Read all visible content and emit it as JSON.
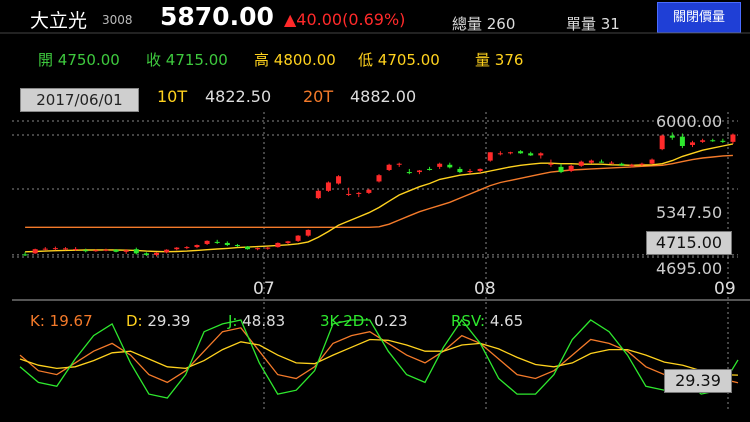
{
  "header": {
    "name": "大立光",
    "code": "3008",
    "price": "5870.00",
    "change": "▲40.00(0.69%)",
    "total_volume": "總量 260",
    "single_volume": "單量 31",
    "toggle_button": "關閉價量"
  },
  "ohlc": {
    "open_label": "開",
    "open": "4750.00",
    "close_label": "收",
    "close": "4715.00",
    "high_label": "高",
    "high": "4800.00",
    "low_label": "低",
    "low": "4705.00",
    "volume_label": "量",
    "volume": "376"
  },
  "selected_date": "2017/06/01",
  "ma": {
    "ma10_label": "10T",
    "ma10_value": "4822.50",
    "ma20_label": "20T",
    "ma20_value": "4882.00"
  },
  "price_axis": {
    "top": "6000.00",
    "mid": "5347.50",
    "selected": "4715.00",
    "bottom": "4695.00"
  },
  "x_ticks": [
    "07",
    "08",
    "09"
  ],
  "kd": {
    "k_label": "K:",
    "k_value": "19.67",
    "d_label": "D:",
    "d_value": "29.39",
    "j_label": "J:",
    "j_value": "48.83",
    "k2d_label": "3K-2D:",
    "k2d_value": "0.23",
    "rsv_label": "RSV:",
    "rsv_value": "4.65",
    "selected": "29.39"
  },
  "colors": {
    "up": "#ff2a2a",
    "down": "#2ee82e",
    "ma10": "#ffd21e",
    "ma20": "#f47a2a",
    "k": "#f47a2a",
    "d": "#ffd21e",
    "j": "#2ee82e"
  },
  "chart_data": [
    {
      "type": "candlestick",
      "title": "",
      "ylim": [
        4695,
        6000
      ],
      "x_ticks": [
        "07",
        "08",
        "09"
      ],
      "candles": [
        {
          "o": 4720,
          "h": 4740,
          "l": 4705,
          "c": 4715
        },
        {
          "o": 4730,
          "h": 4775,
          "l": 4725,
          "c": 4770
        },
        {
          "o": 4770,
          "h": 4790,
          "l": 4760,
          "c": 4775
        },
        {
          "o": 4775,
          "h": 4795,
          "l": 4760,
          "c": 4780
        },
        {
          "o": 4775,
          "h": 4790,
          "l": 4760,
          "c": 4778
        },
        {
          "o": 4770,
          "h": 4790,
          "l": 4755,
          "c": 4772
        },
        {
          "o": 4760,
          "h": 4775,
          "l": 4740,
          "c": 4755
        },
        {
          "o": 4755,
          "h": 4770,
          "l": 4745,
          "c": 4760
        },
        {
          "o": 4760,
          "h": 4775,
          "l": 4750,
          "c": 4765
        },
        {
          "o": 4765,
          "h": 4770,
          "l": 4740,
          "c": 4745
        },
        {
          "o": 4745,
          "h": 4770,
          "l": 4725,
          "c": 4760
        },
        {
          "o": 4770,
          "h": 4785,
          "l": 4720,
          "c": 4730
        },
        {
          "o": 4730,
          "h": 4740,
          "l": 4705,
          "c": 4715
        },
        {
          "o": 4715,
          "h": 4740,
          "l": 4700,
          "c": 4735
        },
        {
          "o": 4740,
          "h": 4770,
          "l": 4730,
          "c": 4765
        },
        {
          "o": 4770,
          "h": 4790,
          "l": 4760,
          "c": 4785
        },
        {
          "o": 4785,
          "h": 4800,
          "l": 4770,
          "c": 4790
        },
        {
          "o": 4790,
          "h": 4815,
          "l": 4780,
          "c": 4810
        },
        {
          "o": 4820,
          "h": 4855,
          "l": 4810,
          "c": 4850
        },
        {
          "o": 4840,
          "h": 4860,
          "l": 4820,
          "c": 4830
        },
        {
          "o": 4830,
          "h": 4845,
          "l": 4800,
          "c": 4810
        },
        {
          "o": 4810,
          "h": 4820,
          "l": 4790,
          "c": 4800
        },
        {
          "o": 4795,
          "h": 4800,
          "l": 4765,
          "c": 4770
        },
        {
          "o": 4770,
          "h": 4785,
          "l": 4760,
          "c": 4780
        },
        {
          "o": 4775,
          "h": 4790,
          "l": 4765,
          "c": 4785
        },
        {
          "o": 4790,
          "h": 4835,
          "l": 4785,
          "c": 4830
        },
        {
          "o": 4830,
          "h": 4850,
          "l": 4820,
          "c": 4845
        },
        {
          "o": 4850,
          "h": 4905,
          "l": 4840,
          "c": 4900
        },
        {
          "o": 4900,
          "h": 4960,
          "l": 4890,
          "c": 4955
        },
        {
          "o": 5260,
          "h": 5340,
          "l": 5250,
          "c": 5330
        },
        {
          "o": 5330,
          "h": 5420,
          "l": 5320,
          "c": 5410
        },
        {
          "o": 5400,
          "h": 5480,
          "l": 5390,
          "c": 5470
        },
        {
          "o": 5300,
          "h": 5360,
          "l": 5280,
          "c": 5300
        },
        {
          "o": 5300,
          "h": 5320,
          "l": 5270,
          "c": 5310
        },
        {
          "o": 5310,
          "h": 5350,
          "l": 5300,
          "c": 5340
        },
        {
          "o": 5420,
          "h": 5490,
          "l": 5410,
          "c": 5480
        },
        {
          "o": 5530,
          "h": 5590,
          "l": 5520,
          "c": 5580
        },
        {
          "o": 5580,
          "h": 5600,
          "l": 5560,
          "c": 5590
        },
        {
          "o": 5510,
          "h": 5540,
          "l": 5490,
          "c": 5500
        },
        {
          "o": 5510,
          "h": 5530,
          "l": 5490,
          "c": 5525
        },
        {
          "o": 5540,
          "h": 5560,
          "l": 5525,
          "c": 5530
        },
        {
          "o": 5560,
          "h": 5600,
          "l": 5540,
          "c": 5590
        },
        {
          "o": 5580,
          "h": 5600,
          "l": 5545,
          "c": 5555
        },
        {
          "o": 5540,
          "h": 5560,
          "l": 5500,
          "c": 5510
        },
        {
          "o": 5510,
          "h": 5540,
          "l": 5495,
          "c": 5520
        },
        {
          "o": 5520,
          "h": 5545,
          "l": 5500,
          "c": 5540
        },
        {
          "o": 5620,
          "h": 5700,
          "l": 5610,
          "c": 5700
        },
        {
          "o": 5690,
          "h": 5710,
          "l": 5670,
          "c": 5690
        },
        {
          "o": 5690,
          "h": 5705,
          "l": 5680,
          "c": 5700
        },
        {
          "o": 5710,
          "h": 5720,
          "l": 5685,
          "c": 5690
        },
        {
          "o": 5690,
          "h": 5705,
          "l": 5665,
          "c": 5670
        },
        {
          "o": 5670,
          "h": 5700,
          "l": 5640,
          "c": 5690
        },
        {
          "o": 5580,
          "h": 5630,
          "l": 5560,
          "c": 5590
        },
        {
          "o": 5560,
          "h": 5590,
          "l": 5500,
          "c": 5510
        },
        {
          "o": 5520,
          "h": 5580,
          "l": 5510,
          "c": 5570
        },
        {
          "o": 5570,
          "h": 5620,
          "l": 5560,
          "c": 5610
        },
        {
          "o": 5600,
          "h": 5630,
          "l": 5590,
          "c": 5620
        },
        {
          "o": 5610,
          "h": 5630,
          "l": 5600,
          "c": 5605
        },
        {
          "o": 5600,
          "h": 5615,
          "l": 5590,
          "c": 5600
        },
        {
          "o": 5590,
          "h": 5600,
          "l": 5570,
          "c": 5575
        },
        {
          "o": 5570,
          "h": 5590,
          "l": 5555,
          "c": 5580
        },
        {
          "o": 5580,
          "h": 5600,
          "l": 5570,
          "c": 5590
        },
        {
          "o": 5590,
          "h": 5640,
          "l": 5585,
          "c": 5630
        },
        {
          "o": 5730,
          "h": 5870,
          "l": 5720,
          "c": 5860
        },
        {
          "o": 5860,
          "h": 5890,
          "l": 5820,
          "c": 5840
        },
        {
          "o": 5850,
          "h": 5880,
          "l": 5740,
          "c": 5760
        },
        {
          "o": 5770,
          "h": 5810,
          "l": 5750,
          "c": 5795
        },
        {
          "o": 5800,
          "h": 5830,
          "l": 5790,
          "c": 5815
        },
        {
          "o": 5815,
          "h": 5830,
          "l": 5800,
          "c": 5810
        },
        {
          "o": 5810,
          "h": 5830,
          "l": 5790,
          "c": 5800
        },
        {
          "o": 5800,
          "h": 5880,
          "l": 5780,
          "c": 5870
        }
      ],
      "ma10": [
        4745,
        4748,
        4752,
        4755,
        4758,
        4760,
        4762,
        4762,
        4763,
        4762,
        4760,
        4758,
        4752,
        4748,
        4746,
        4748,
        4752,
        4758,
        4765,
        4772,
        4778,
        4785,
        4790,
        4795,
        4800,
        4806,
        4812,
        4822,
        4840,
        4885,
        4940,
        5000,
        5040,
        5080,
        5120,
        5170,
        5230,
        5290,
        5330,
        5370,
        5400,
        5440,
        5460,
        5480,
        5490,
        5500,
        5520,
        5540,
        5560,
        5575,
        5585,
        5595,
        5595,
        5590,
        5590,
        5585,
        5585,
        5585,
        5580,
        5578,
        5575,
        5578,
        5580,
        5590,
        5620,
        5660,
        5690,
        5720,
        5740,
        5760,
        5780
      ],
      "ma20": [
        4980,
        4980,
        4980,
        4980,
        4980,
        4980,
        4980,
        4980,
        4980,
        4980,
        4980,
        4980,
        4980,
        4980,
        4980,
        4980,
        4980,
        4980,
        4980,
        4980,
        4980,
        4980,
        4980,
        4980,
        4980,
        4980,
        4980,
        4980,
        4980,
        4980,
        4980,
        4980,
        4980,
        4980,
        4980,
        4985,
        5010,
        5050,
        5090,
        5130,
        5160,
        5190,
        5220,
        5260,
        5300,
        5340,
        5380,
        5410,
        5430,
        5450,
        5470,
        5490,
        5510,
        5520,
        5530,
        5535,
        5540,
        5545,
        5550,
        5555,
        5560,
        5565,
        5570,
        5575,
        5590,
        5610,
        5630,
        5645,
        5655,
        5665,
        5670
      ]
    },
    {
      "type": "line",
      "title": "KD",
      "ylim": [
        0,
        100
      ],
      "series": [
        {
          "name": "K",
          "values": [
            55,
            35,
            30,
            45,
            60,
            70,
            55,
            30,
            20,
            35,
            60,
            85,
            90,
            60,
            30,
            25,
            40,
            70,
            80,
            85,
            70,
            55,
            45,
            60,
            80,
            70,
            50,
            30,
            25,
            35,
            55,
            75,
            70,
            60,
            40,
            30,
            35,
            20,
            25,
            19.67
          ]
        },
        {
          "name": "D",
          "values": [
            50,
            42,
            38,
            40,
            48,
            58,
            60,
            50,
            40,
            38,
            48,
            62,
            72,
            68,
            55,
            45,
            44,
            55,
            65,
            75,
            74,
            68,
            60,
            60,
            68,
            70,
            63,
            52,
            43,
            40,
            45,
            57,
            62,
            62,
            55,
            46,
            42,
            35,
            30,
            29.39
          ]
        },
        {
          "name": "J",
          "values": [
            40,
            20,
            15,
            50,
            80,
            95,
            45,
            5,
            0,
            30,
            85,
            95,
            100,
            45,
            5,
            10,
            35,
            95,
            100,
            100,
            60,
            30,
            20,
            65,
            100,
            70,
            25,
            5,
            5,
            30,
            75,
            100,
            85,
            55,
            15,
            10,
            25,
            5,
            10,
            48.83
          ]
        }
      ]
    }
  ]
}
